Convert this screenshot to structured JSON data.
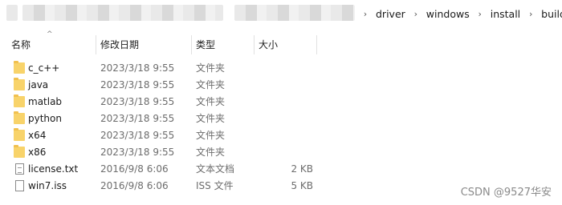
{
  "breadcrumbs": [
    "driver",
    "windows",
    "install",
    "build"
  ],
  "columns": {
    "name": "名称",
    "modified": "修改日期",
    "type": "类型",
    "size": "大小"
  },
  "files": [
    {
      "name": "c_c++",
      "date": "2023/3/18 9:55",
      "type": "文件夹",
      "size": "",
      "icon": "folder-icon"
    },
    {
      "name": "java",
      "date": "2023/3/18 9:55",
      "type": "文件夹",
      "size": "",
      "icon": "folder-icon"
    },
    {
      "name": "matlab",
      "date": "2023/3/18 9:55",
      "type": "文件夹",
      "size": "",
      "icon": "folder-icon"
    },
    {
      "name": "python",
      "date": "2023/3/18 9:55",
      "type": "文件夹",
      "size": "",
      "icon": "folder-icon"
    },
    {
      "name": "x64",
      "date": "2023/3/18 9:55",
      "type": "文件夹",
      "size": "",
      "icon": "folder-icon"
    },
    {
      "name": "x86",
      "date": "2023/3/18 9:55",
      "type": "文件夹",
      "size": "",
      "icon": "folder-icon"
    },
    {
      "name": "license.txt",
      "date": "2016/9/8 6:06",
      "type": "文本文档",
      "size": "2 KB",
      "icon": "text-file-icon"
    },
    {
      "name": "win7.iss",
      "date": "2016/9/8 6:06",
      "type": "ISS 文件",
      "size": "5 KB",
      "icon": "file-icon"
    }
  ],
  "watermark": "CSDN @9527华安"
}
